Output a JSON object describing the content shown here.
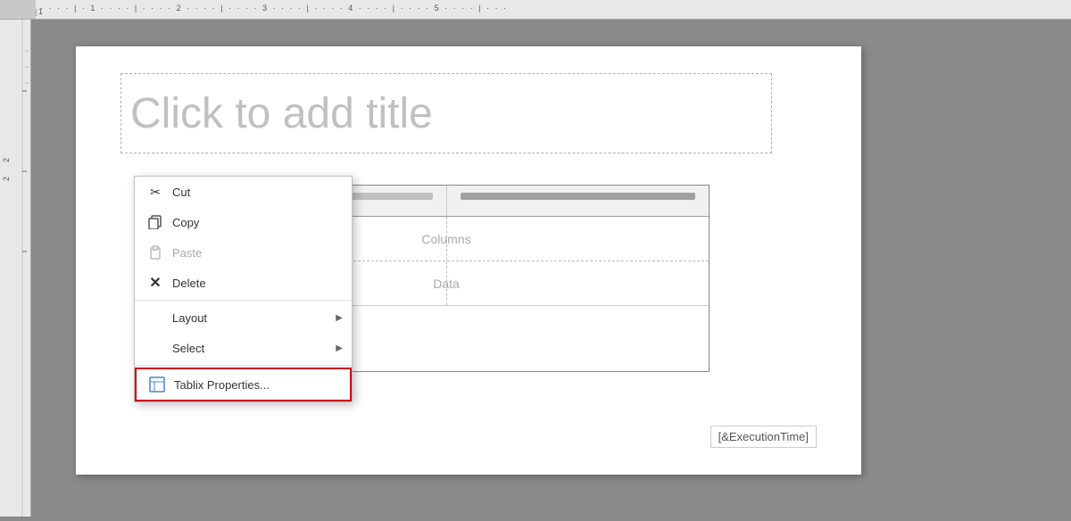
{
  "ruler": {
    "top_markings": "· · · · | · 1 · · · · | · · · · 2 · · · · | · · · · 3 · · · · | · · · · 4 · · · · | · · · · 5 · · · · | · · ·"
  },
  "page": {
    "title_placeholder": "Click to add title"
  },
  "table": {
    "columns_label": "Columns",
    "data_label": "Data"
  },
  "footer": {
    "execution_time": "[&ExecutionTime]"
  },
  "context_menu": {
    "items": [
      {
        "id": "cut",
        "label": "Cut",
        "icon": "✂",
        "disabled": false,
        "has_submenu": false
      },
      {
        "id": "copy",
        "label": "Copy",
        "icon": "⧉",
        "disabled": false,
        "has_submenu": false
      },
      {
        "id": "paste",
        "label": "Paste",
        "icon": "📋",
        "disabled": true,
        "has_submenu": false
      },
      {
        "id": "delete",
        "label": "Delete",
        "icon": "✕",
        "disabled": false,
        "has_submenu": false
      },
      {
        "id": "layout",
        "label": "Layout",
        "icon": "",
        "disabled": false,
        "has_submenu": true
      },
      {
        "id": "select",
        "label": "Select",
        "icon": "",
        "disabled": false,
        "has_submenu": true
      },
      {
        "id": "tablix-properties",
        "label": "Tablix Properties...",
        "icon": "⊞",
        "disabled": false,
        "has_submenu": false,
        "highlighted": true
      }
    ]
  }
}
